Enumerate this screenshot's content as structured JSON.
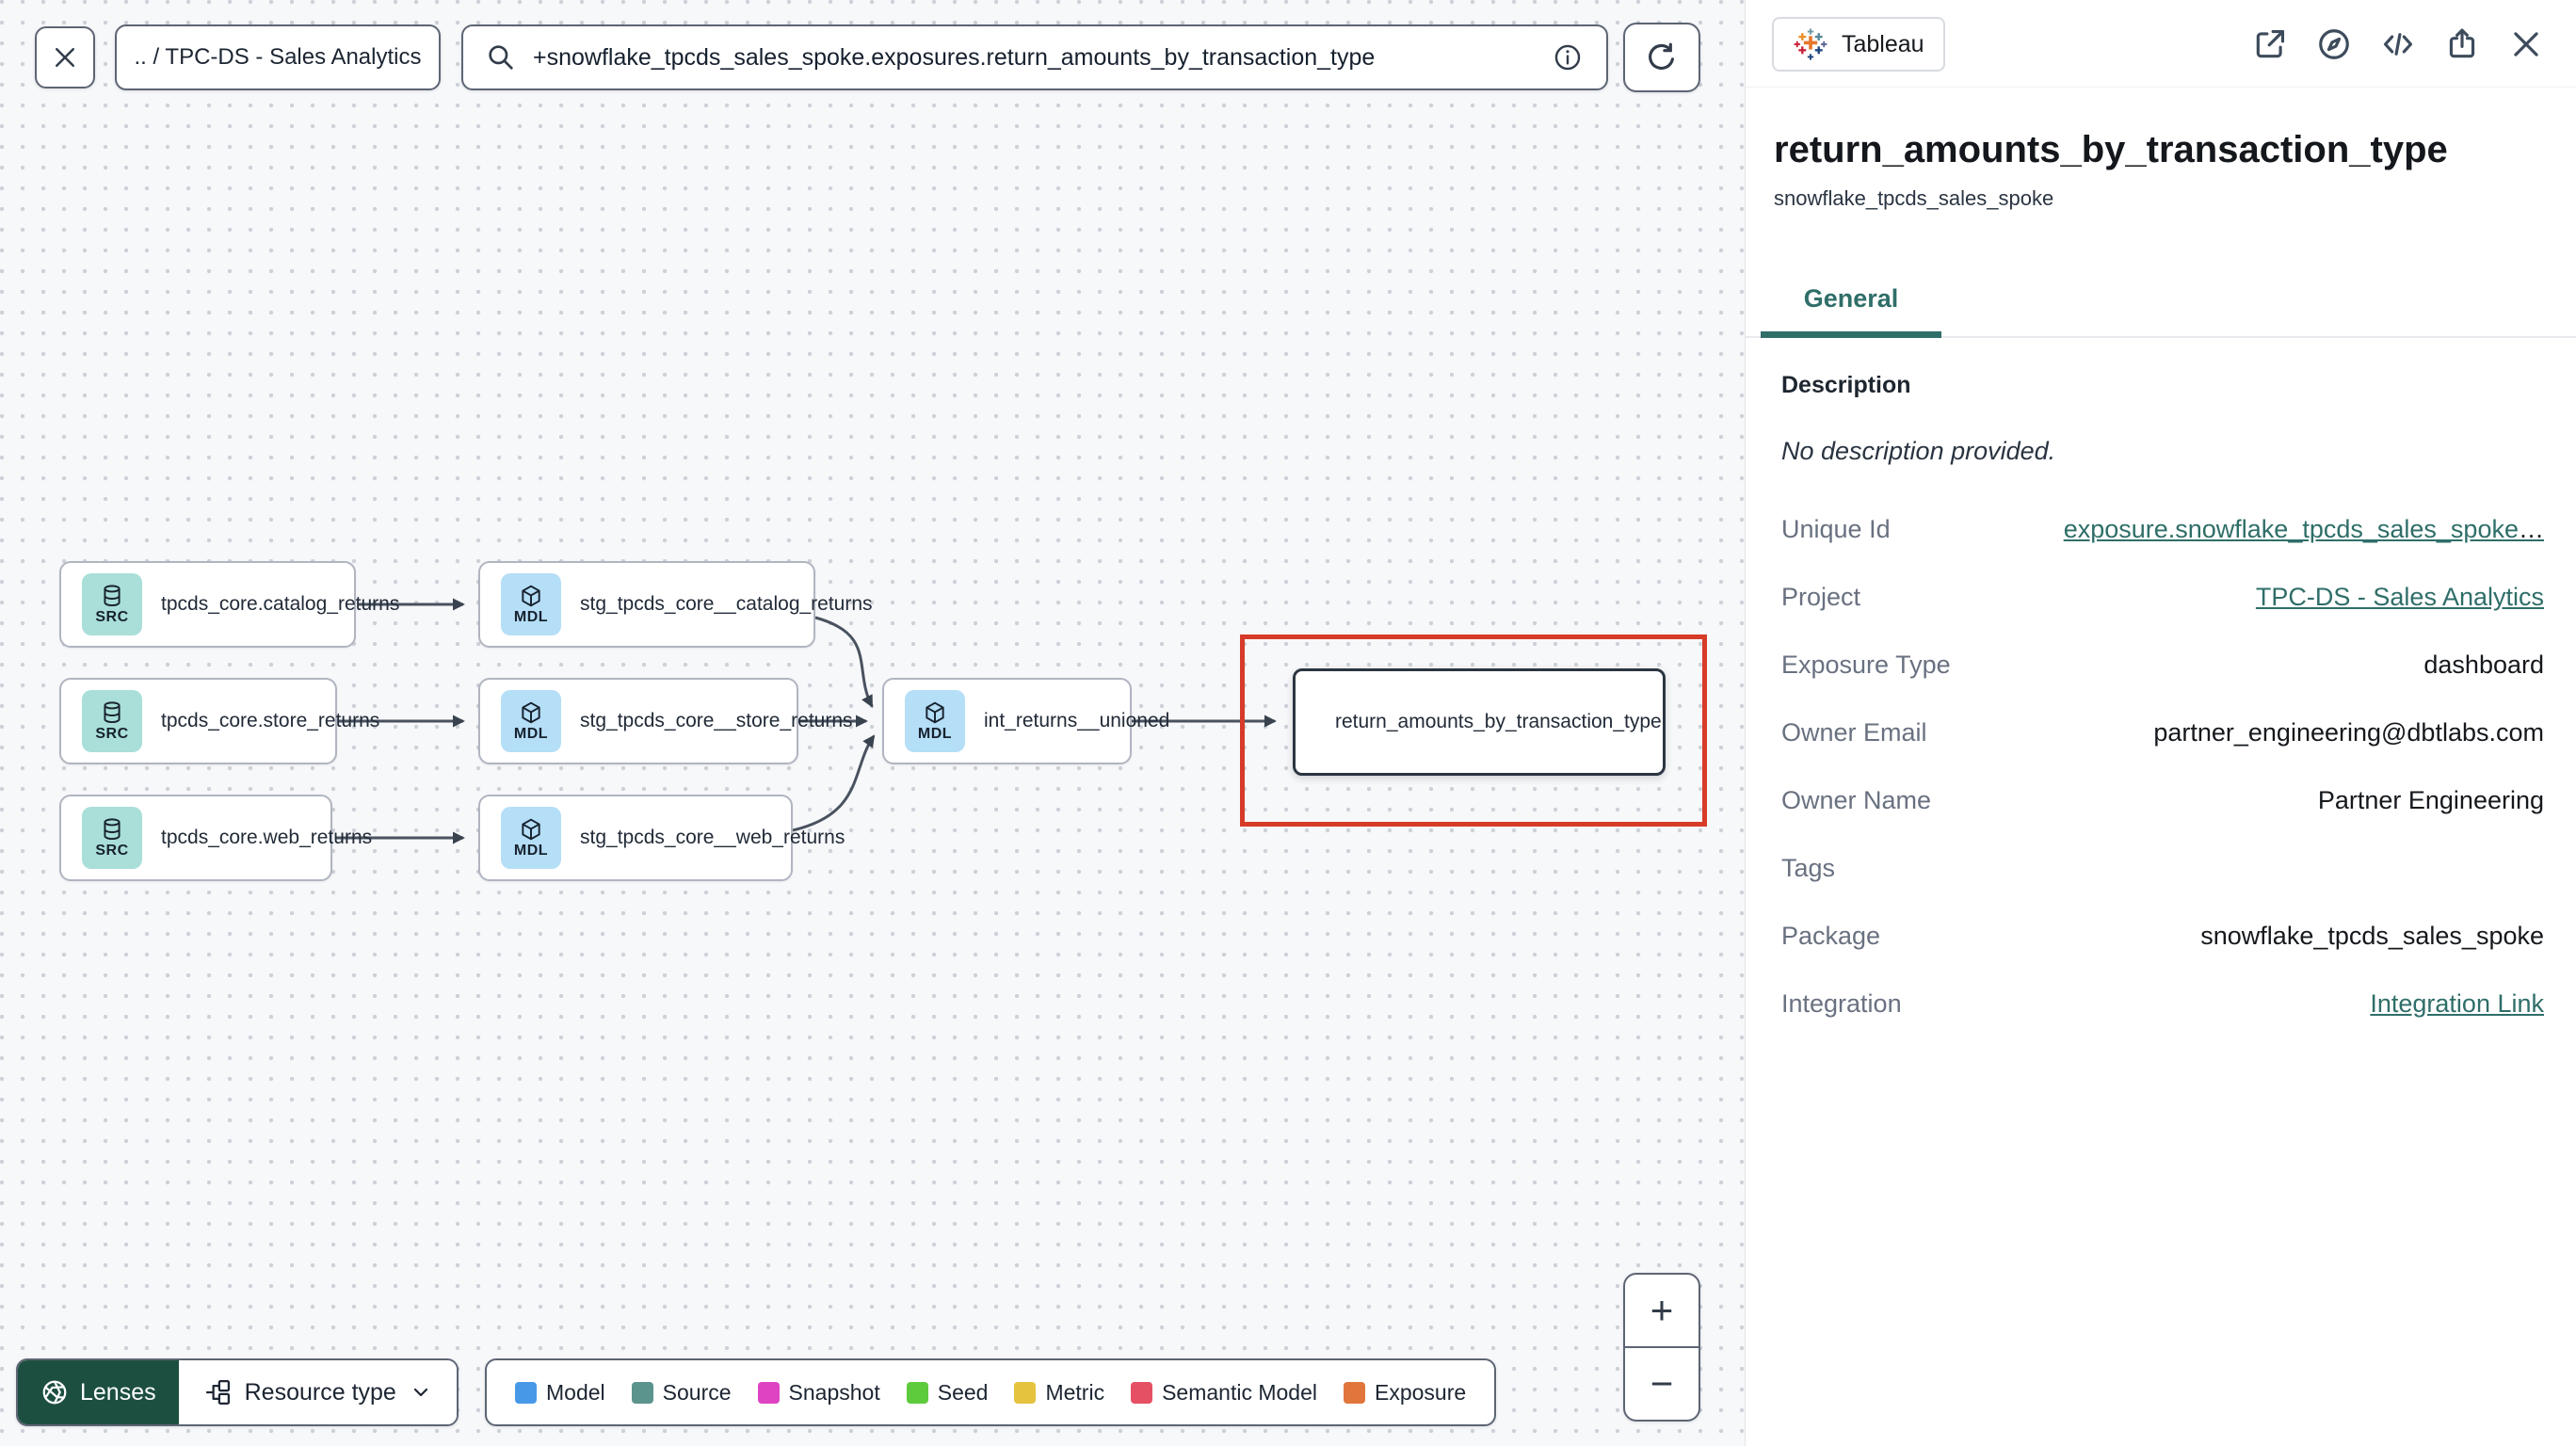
{
  "toolbar": {
    "breadcrumb": ".. / TPC-DS - Sales Analytics",
    "search_value": "+snowflake_tpcds_sales_spoke.exposures.return_amounts_by_transaction_type"
  },
  "graph": {
    "nodes": [
      {
        "badge": "SRC",
        "label": "tpcds_core.catalog_returns",
        "type": "source"
      },
      {
        "badge": "MDL",
        "label": "stg_tpcds_core__catalog_returns",
        "type": "model"
      },
      {
        "badge": "SRC",
        "label": "tpcds_core.store_returns",
        "type": "source"
      },
      {
        "badge": "MDL",
        "label": "stg_tpcds_core__store_returns",
        "type": "model"
      },
      {
        "badge": "SRC",
        "label": "tpcds_core.web_returns",
        "type": "source"
      },
      {
        "badge": "MDL",
        "label": "stg_tpcds_core__web_returns",
        "type": "model"
      },
      {
        "badge": "MDL",
        "label": "int_returns__unioned",
        "type": "model"
      },
      {
        "label": "return_amounts_by_transaction_type",
        "type": "exposure"
      }
    ]
  },
  "controls": {
    "lenses_label": "Lenses",
    "resource_type_label": "Resource type",
    "zoom_in": "+",
    "zoom_out": "−"
  },
  "legend": {
    "items": [
      {
        "label": "Model",
        "color": "#4799e8"
      },
      {
        "label": "Source",
        "color": "#5b938d"
      },
      {
        "label": "Snapshot",
        "color": "#de44c2"
      },
      {
        "label": "Seed",
        "color": "#5ecb3d"
      },
      {
        "label": "Metric",
        "color": "#e6c33f"
      },
      {
        "label": "Semantic Model",
        "color": "#e55064"
      },
      {
        "label": "Exposure",
        "color": "#e0763c"
      }
    ]
  },
  "panel": {
    "source_badge": "Tableau",
    "title": "return_amounts_by_transaction_type",
    "subtitle": "snowflake_tpcds_sales_spoke",
    "tab": "General",
    "description_heading": "Description",
    "description_empty": "No description provided.",
    "fields": [
      {
        "label": "Unique Id",
        "value": "exposure.snowflake_tpcds_sales_spoke",
        "suffix": "…",
        "link": true
      },
      {
        "label": "Project",
        "value": "TPC-DS - Sales Analytics",
        "link": true
      },
      {
        "label": "Exposure Type",
        "value": "dashboard",
        "link": false
      },
      {
        "label": "Owner Email",
        "value": "partner_engineering@dbtlabs.com",
        "link": false
      },
      {
        "label": "Owner Name",
        "value": "Partner Engineering",
        "link": false
      },
      {
        "label": "Tags",
        "value": "",
        "link": false
      },
      {
        "label": "Package",
        "value": "snowflake_tpcds_sales_spoke",
        "link": false
      },
      {
        "label": "Integration",
        "value": "Integration Link",
        "link": true
      }
    ]
  },
  "colors": {
    "accent_teal": "#2f6e69",
    "highlight_red": "#d63b28",
    "lenses_green": "#1d4f41",
    "source_chip": "#a9dfd8",
    "model_chip": "#b5def7"
  }
}
